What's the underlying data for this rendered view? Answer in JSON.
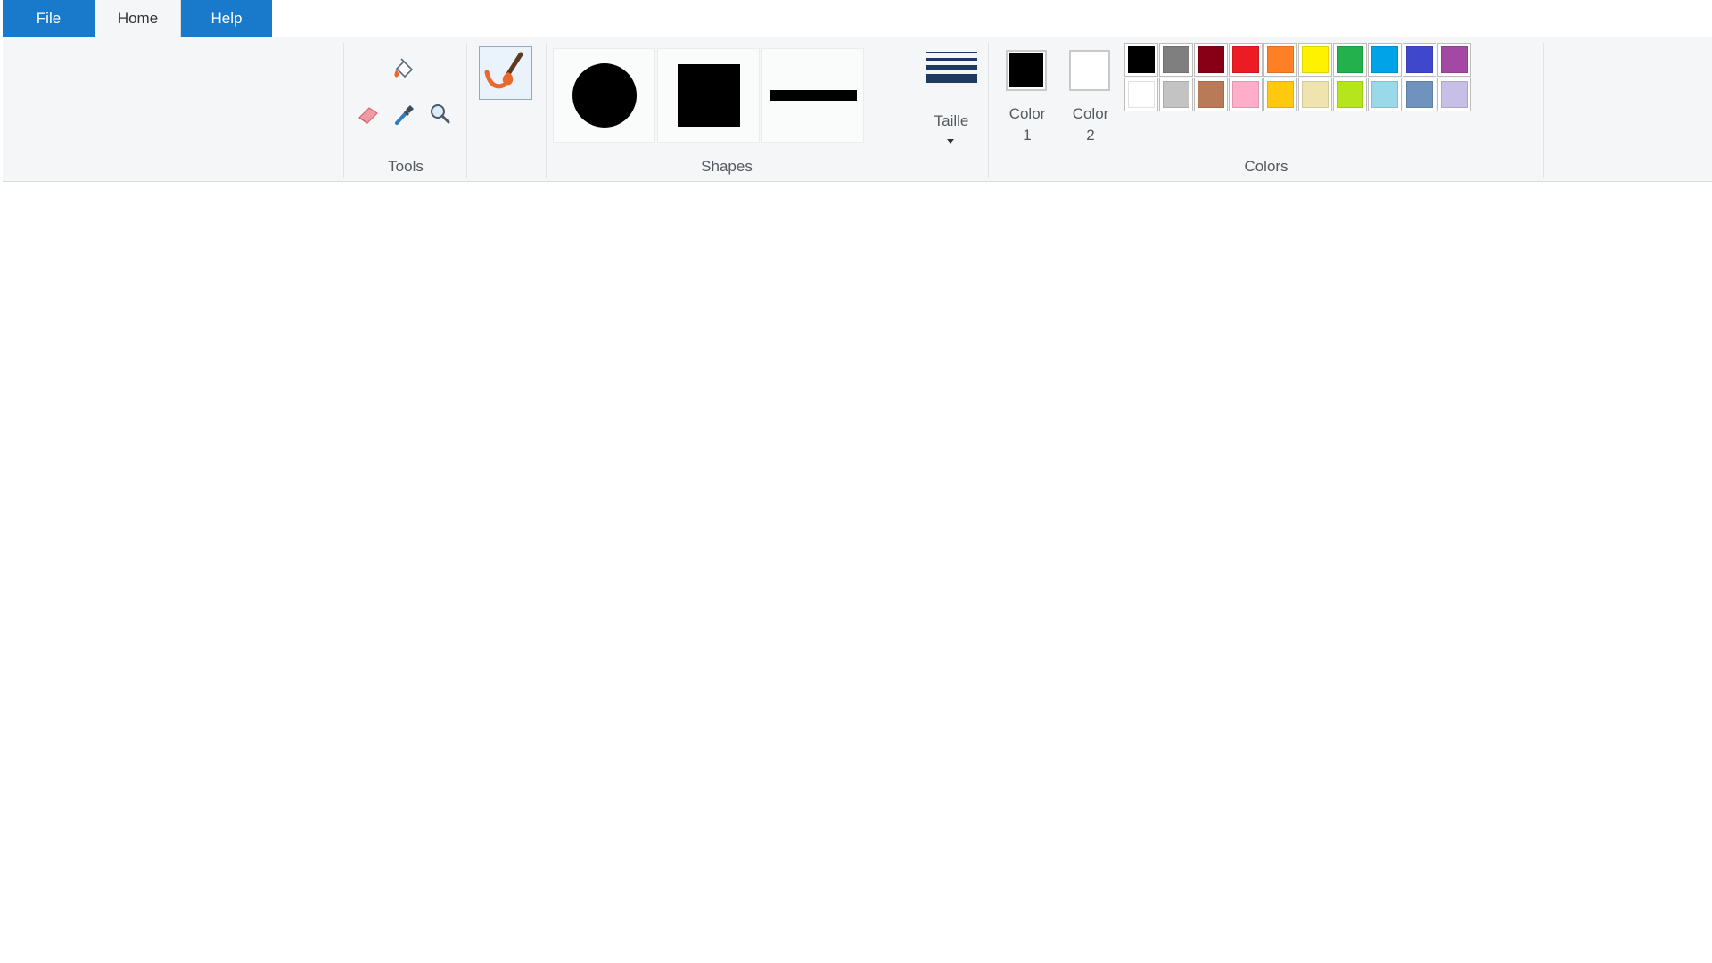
{
  "tabs": {
    "file": "File",
    "home": "Home",
    "help": "Help"
  },
  "groups": {
    "tools": "Tools",
    "shapes": "Shapes",
    "colors": "Colors"
  },
  "tools": [
    "fill-bucket-icon",
    "eraser-icon",
    "color-picker-icon",
    "magnifier-icon"
  ],
  "brush": {
    "icon": "brush-icon"
  },
  "shapes": [
    "oval",
    "rectangle",
    "line"
  ],
  "size": {
    "label": "Taille",
    "icon": "line-size-icon"
  },
  "color1": {
    "label_line1": "Color",
    "label_line2": "1",
    "value": "#000000"
  },
  "color2": {
    "label_line1": "Color",
    "label_line2": "2",
    "value": "#ffffff"
  },
  "palette": {
    "row1": [
      "#000000",
      "#7f7f7f",
      "#880015",
      "#ed1c24",
      "#ff7f27",
      "#fff200",
      "#22b14c",
      "#00a2e8",
      "#3f48cc",
      "#a349a4"
    ],
    "row2": [
      "#ffffff",
      "#c3c3c3",
      "#b97a57",
      "#ffaec9",
      "#ffc90e",
      "#efe4b0",
      "#b5e61d",
      "#99d9ea",
      "#7092be",
      "#c8bfe7"
    ]
  },
  "accent": "#1979ca"
}
